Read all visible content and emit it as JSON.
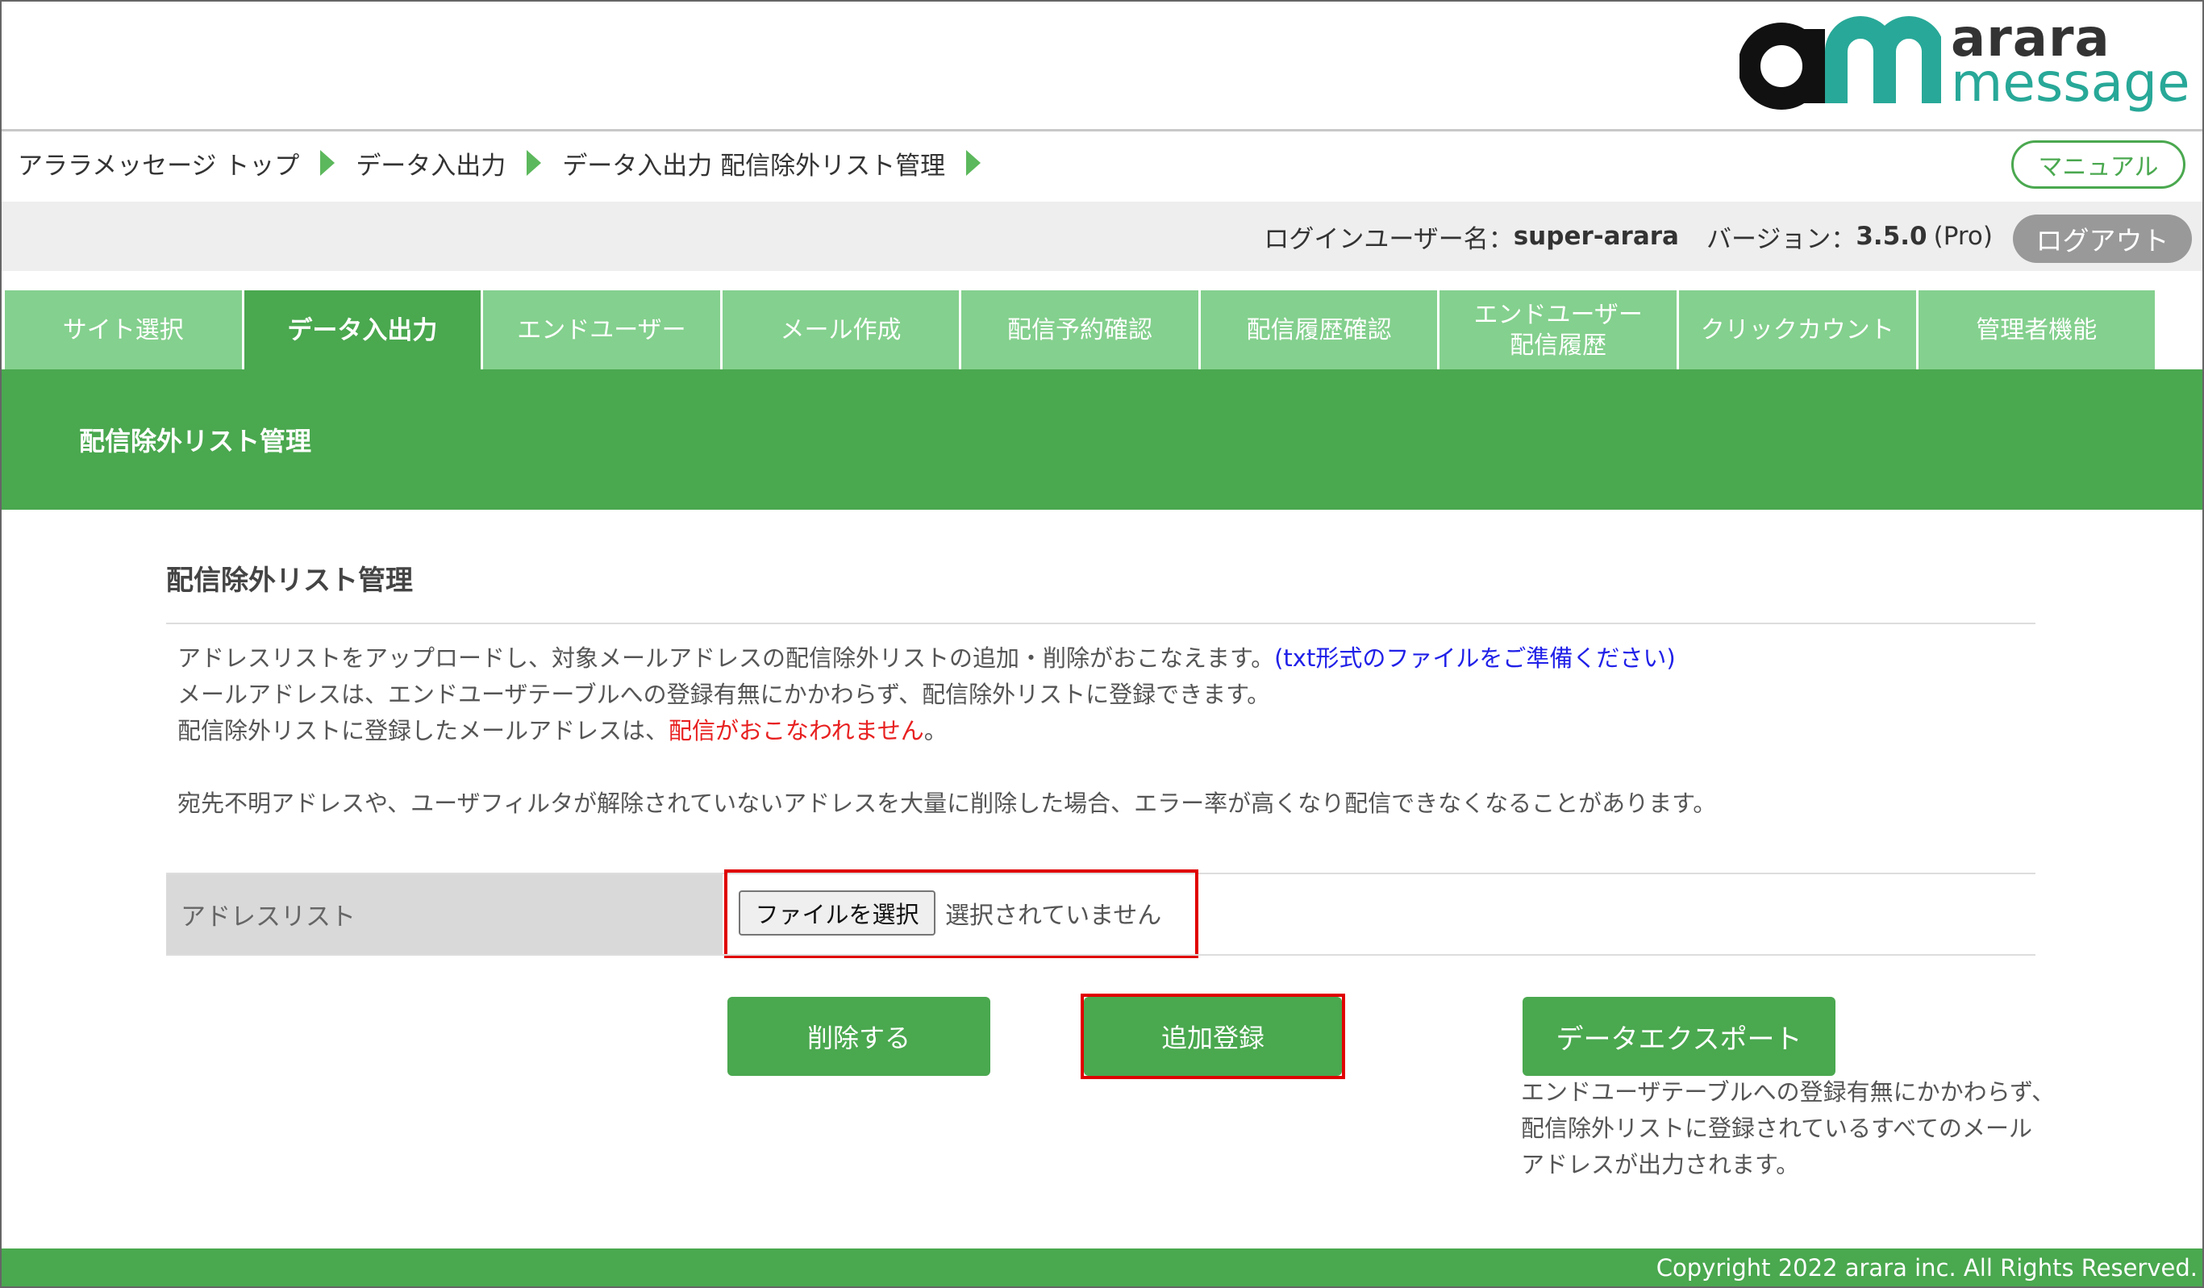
{
  "logo": {
    "brand_top": "arara",
    "brand_bottom": "message"
  },
  "breadcrumb": [
    "アララメッセージ トップ",
    "データ入出力",
    "データ入出力 配信除外リスト管理"
  ],
  "manual_label": "マニュアル",
  "user_bar": {
    "login_label": "ログインユーザー名：",
    "username": "super-arara",
    "version_label": "バージョン：",
    "version": "3.5.0",
    "edition": "(Pro)",
    "logout_label": "ログアウト"
  },
  "tabs": [
    {
      "line1": "サイト選択",
      "line2": ""
    },
    {
      "line1": "データ入出力",
      "line2": ""
    },
    {
      "line1": "エンドユーザー",
      "line2": ""
    },
    {
      "line1": "メール作成",
      "line2": ""
    },
    {
      "line1": "配信予約確認",
      "line2": ""
    },
    {
      "line1": "配信履歴確認",
      "line2": ""
    },
    {
      "line1": "エンドユーザー",
      "line2": "配信履歴"
    },
    {
      "line1": "クリックカウント",
      "line2": ""
    },
    {
      "line1": "管理者機能",
      "line2": ""
    }
  ],
  "section": {
    "title": "配信除外リスト管理"
  },
  "content": {
    "title": "配信除外リスト管理",
    "desc_line1": "アドレスリストをアップロードし、対象メールアドレスの配信除外リストの追加・削除がおこなえます。",
    "desc_line1_note": "(txt形式のファイルをご準備ください)",
    "desc_line2": "メールアドレスは、エンドユーザテーブルへの登録有無にかかわらず、配信除外リストに登録できます。",
    "desc_line3_a": "配信除外リストに登録したメールアドレスは、",
    "desc_line3_red": "配信がおこなわれません",
    "desc_line3_b": "。",
    "desc_line4": "宛先不明アドレスや、ユーザフィルタが解除されていないアドレスを大量に削除した場合、エラー率が高くなり配信できなくなることがあります。"
  },
  "form": {
    "label": "アドレスリスト",
    "file_button": "ファイルを選択",
    "file_status": "選択されていません"
  },
  "actions": {
    "delete": "削除する",
    "add": "追加登録",
    "export": "データエクスポート",
    "export_note": [
      "エンドユーザテーブルへの登録有無にかかわらず、",
      "配信除外リストに登録されているすべてのメール",
      "アドレスが出力されます。"
    ]
  },
  "footer": {
    "copyright": "Copyright 2022 arara inc. All Rights Reserved."
  },
  "colors": {
    "accent": "#4aa84f",
    "tab": "#84d08e",
    "highlight": "#e00000",
    "brand_teal": "#28a898"
  }
}
